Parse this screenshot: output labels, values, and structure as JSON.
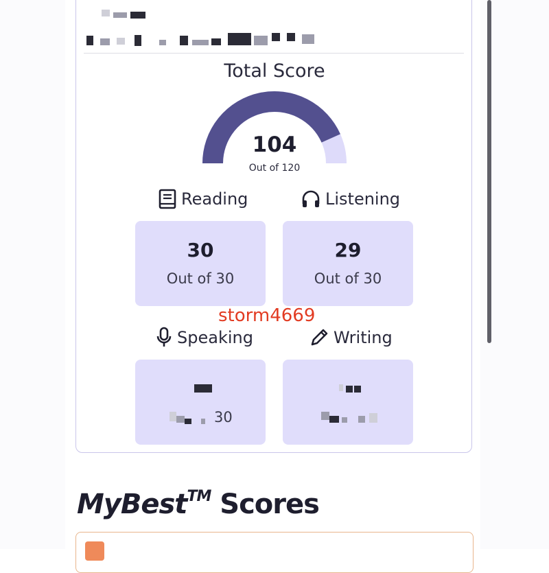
{
  "total": {
    "title": "Total Score",
    "score": "104",
    "out_of": "Out of 120",
    "fraction": 0.867,
    "colors": {
      "filled": "#53508f",
      "remaining": "#dedbfa"
    }
  },
  "sections": [
    {
      "id": "reading",
      "label": "Reading",
      "icon": "book-icon",
      "score": "30",
      "out_of": "Out of 30"
    },
    {
      "id": "listening",
      "label": "Listening",
      "icon": "headphones-icon",
      "score": "29",
      "out_of": "Out of 30"
    },
    {
      "id": "speaking",
      "label": "Speaking",
      "icon": "microphone-icon",
      "score": "",
      "out_of": "30"
    },
    {
      "id": "writing",
      "label": "Writing",
      "icon": "pencil-icon",
      "score": "",
      "out_of": ""
    }
  ],
  "watermark": "storm4669",
  "mybest": {
    "brand": "MyBest",
    "trademark": "TM",
    "suffix": "Scores"
  },
  "colors": {
    "box_bg": "#e0ddfb",
    "card_border": "#c9c5ea",
    "best_border": "#e8b58c",
    "accent_orange": "#ef8a5a"
  }
}
